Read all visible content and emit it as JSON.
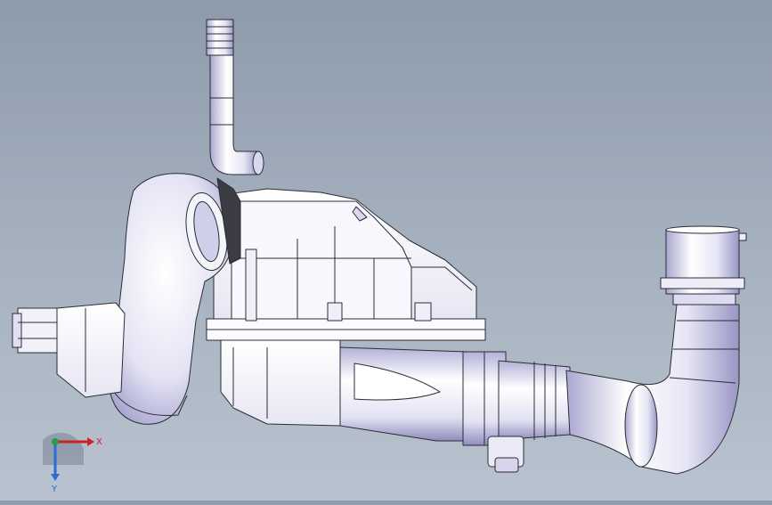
{
  "viewport": {
    "background_top": "#8e9bab",
    "background_bottom": "#b9c3cf",
    "model_fill": "#f3f3fb",
    "model_shade": "#b8b6d6",
    "edge_color": "#2c2c34"
  },
  "triad": {
    "x_label": "X",
    "y_label": "Y",
    "x_color": "#cc2222",
    "y_color": "#2a6bd6",
    "z_color": "#22a04a"
  }
}
